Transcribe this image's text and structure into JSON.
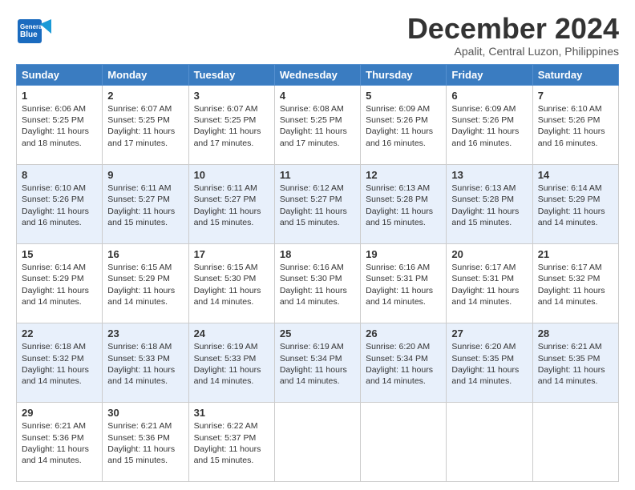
{
  "header": {
    "logo_general": "General",
    "logo_blue": "Blue",
    "month_title": "December 2024",
    "subtitle": "Apalit, Central Luzon, Philippines"
  },
  "days_of_week": [
    "Sunday",
    "Monday",
    "Tuesday",
    "Wednesday",
    "Thursday",
    "Friday",
    "Saturday"
  ],
  "weeks": [
    [
      {
        "day": "1",
        "sunrise": "Sunrise: 6:06 AM",
        "sunset": "Sunset: 5:25 PM",
        "daylight": "Daylight: 11 hours and 18 minutes."
      },
      {
        "day": "2",
        "sunrise": "Sunrise: 6:07 AM",
        "sunset": "Sunset: 5:25 PM",
        "daylight": "Daylight: 11 hours and 17 minutes."
      },
      {
        "day": "3",
        "sunrise": "Sunrise: 6:07 AM",
        "sunset": "Sunset: 5:25 PM",
        "daylight": "Daylight: 11 hours and 17 minutes."
      },
      {
        "day": "4",
        "sunrise": "Sunrise: 6:08 AM",
        "sunset": "Sunset: 5:25 PM",
        "daylight": "Daylight: 11 hours and 17 minutes."
      },
      {
        "day": "5",
        "sunrise": "Sunrise: 6:09 AM",
        "sunset": "Sunset: 5:26 PM",
        "daylight": "Daylight: 11 hours and 16 minutes."
      },
      {
        "day": "6",
        "sunrise": "Sunrise: 6:09 AM",
        "sunset": "Sunset: 5:26 PM",
        "daylight": "Daylight: 11 hours and 16 minutes."
      },
      {
        "day": "7",
        "sunrise": "Sunrise: 6:10 AM",
        "sunset": "Sunset: 5:26 PM",
        "daylight": "Daylight: 11 hours and 16 minutes."
      }
    ],
    [
      {
        "day": "8",
        "sunrise": "Sunrise: 6:10 AM",
        "sunset": "Sunset: 5:26 PM",
        "daylight": "Daylight: 11 hours and 16 minutes."
      },
      {
        "day": "9",
        "sunrise": "Sunrise: 6:11 AM",
        "sunset": "Sunset: 5:27 PM",
        "daylight": "Daylight: 11 hours and 15 minutes."
      },
      {
        "day": "10",
        "sunrise": "Sunrise: 6:11 AM",
        "sunset": "Sunset: 5:27 PM",
        "daylight": "Daylight: 11 hours and 15 minutes."
      },
      {
        "day": "11",
        "sunrise": "Sunrise: 6:12 AM",
        "sunset": "Sunset: 5:27 PM",
        "daylight": "Daylight: 11 hours and 15 minutes."
      },
      {
        "day": "12",
        "sunrise": "Sunrise: 6:13 AM",
        "sunset": "Sunset: 5:28 PM",
        "daylight": "Daylight: 11 hours and 15 minutes."
      },
      {
        "day": "13",
        "sunrise": "Sunrise: 6:13 AM",
        "sunset": "Sunset: 5:28 PM",
        "daylight": "Daylight: 11 hours and 15 minutes."
      },
      {
        "day": "14",
        "sunrise": "Sunrise: 6:14 AM",
        "sunset": "Sunset: 5:29 PM",
        "daylight": "Daylight: 11 hours and 14 minutes."
      }
    ],
    [
      {
        "day": "15",
        "sunrise": "Sunrise: 6:14 AM",
        "sunset": "Sunset: 5:29 PM",
        "daylight": "Daylight: 11 hours and 14 minutes."
      },
      {
        "day": "16",
        "sunrise": "Sunrise: 6:15 AM",
        "sunset": "Sunset: 5:29 PM",
        "daylight": "Daylight: 11 hours and 14 minutes."
      },
      {
        "day": "17",
        "sunrise": "Sunrise: 6:15 AM",
        "sunset": "Sunset: 5:30 PM",
        "daylight": "Daylight: 11 hours and 14 minutes."
      },
      {
        "day": "18",
        "sunrise": "Sunrise: 6:16 AM",
        "sunset": "Sunset: 5:30 PM",
        "daylight": "Daylight: 11 hours and 14 minutes."
      },
      {
        "day": "19",
        "sunrise": "Sunrise: 6:16 AM",
        "sunset": "Sunset: 5:31 PM",
        "daylight": "Daylight: 11 hours and 14 minutes."
      },
      {
        "day": "20",
        "sunrise": "Sunrise: 6:17 AM",
        "sunset": "Sunset: 5:31 PM",
        "daylight": "Daylight: 11 hours and 14 minutes."
      },
      {
        "day": "21",
        "sunrise": "Sunrise: 6:17 AM",
        "sunset": "Sunset: 5:32 PM",
        "daylight": "Daylight: 11 hours and 14 minutes."
      }
    ],
    [
      {
        "day": "22",
        "sunrise": "Sunrise: 6:18 AM",
        "sunset": "Sunset: 5:32 PM",
        "daylight": "Daylight: 11 hours and 14 minutes."
      },
      {
        "day": "23",
        "sunrise": "Sunrise: 6:18 AM",
        "sunset": "Sunset: 5:33 PM",
        "daylight": "Daylight: 11 hours and 14 minutes."
      },
      {
        "day": "24",
        "sunrise": "Sunrise: 6:19 AM",
        "sunset": "Sunset: 5:33 PM",
        "daylight": "Daylight: 11 hours and 14 minutes."
      },
      {
        "day": "25",
        "sunrise": "Sunrise: 6:19 AM",
        "sunset": "Sunset: 5:34 PM",
        "daylight": "Daylight: 11 hours and 14 minutes."
      },
      {
        "day": "26",
        "sunrise": "Sunrise: 6:20 AM",
        "sunset": "Sunset: 5:34 PM",
        "daylight": "Daylight: 11 hours and 14 minutes."
      },
      {
        "day": "27",
        "sunrise": "Sunrise: 6:20 AM",
        "sunset": "Sunset: 5:35 PM",
        "daylight": "Daylight: 11 hours and 14 minutes."
      },
      {
        "day": "28",
        "sunrise": "Sunrise: 6:21 AM",
        "sunset": "Sunset: 5:35 PM",
        "daylight": "Daylight: 11 hours and 14 minutes."
      }
    ],
    [
      {
        "day": "29",
        "sunrise": "Sunrise: 6:21 AM",
        "sunset": "Sunset: 5:36 PM",
        "daylight": "Daylight: 11 hours and 14 minutes."
      },
      {
        "day": "30",
        "sunrise": "Sunrise: 6:21 AM",
        "sunset": "Sunset: 5:36 PM",
        "daylight": "Daylight: 11 hours and 15 minutes."
      },
      {
        "day": "31",
        "sunrise": "Sunrise: 6:22 AM",
        "sunset": "Sunset: 5:37 PM",
        "daylight": "Daylight: 11 hours and 15 minutes."
      },
      {
        "day": "",
        "sunrise": "",
        "sunset": "",
        "daylight": ""
      },
      {
        "day": "",
        "sunrise": "",
        "sunset": "",
        "daylight": ""
      },
      {
        "day": "",
        "sunrise": "",
        "sunset": "",
        "daylight": ""
      },
      {
        "day": "",
        "sunrise": "",
        "sunset": "",
        "daylight": ""
      }
    ]
  ]
}
